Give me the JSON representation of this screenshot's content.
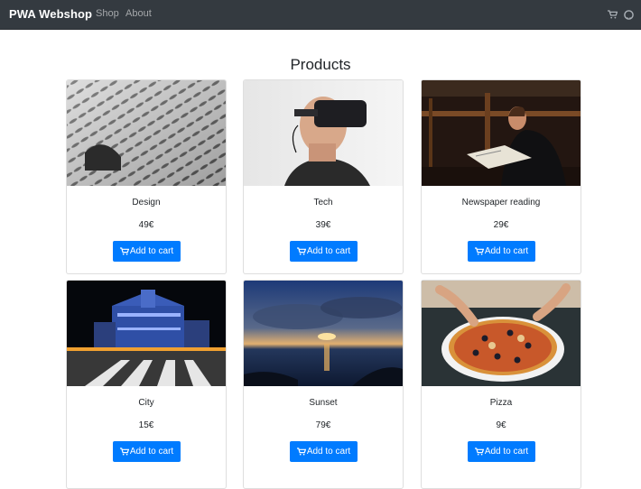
{
  "navbar": {
    "brand": "PWA Webshop",
    "links": [
      "Shop",
      "About"
    ],
    "icons": [
      "shopping-cart-icon",
      "github-icon"
    ],
    "background": "#343a40"
  },
  "page": {
    "title": "Products"
  },
  "accent_color": "#007bff",
  "products": [
    {
      "name": "Design",
      "price": "49€",
      "button": "Add to cart"
    },
    {
      "name": "Tech",
      "price": "39€",
      "button": "Add to cart"
    },
    {
      "name": "Newspaper reading",
      "price": "29€",
      "button": "Add to cart"
    },
    {
      "name": "City",
      "price": "15€",
      "button": "Add to cart"
    },
    {
      "name": "Sunset",
      "price": "79€",
      "button": "Add to cart"
    },
    {
      "name": "Pizza",
      "price": "9€",
      "button": "Add to cart"
    }
  ]
}
